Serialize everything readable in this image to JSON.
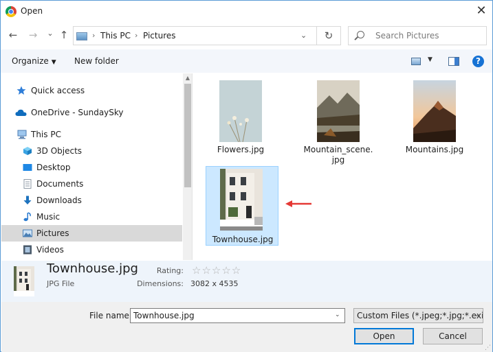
{
  "window": {
    "title": "Open",
    "close_glyph": "✕"
  },
  "nav": {
    "back_glyph": "←",
    "forward_glyph": "→",
    "recent_glyph": "⌄",
    "up_glyph": "↑",
    "breadcrumb": [
      "This PC",
      "Pictures"
    ],
    "separator": "›",
    "dropdown_glyph": "⌄",
    "refresh_glyph": "↻",
    "search_placeholder": "Search Pictures"
  },
  "toolbar": {
    "organize_label": "Organize",
    "caret": "▼",
    "new_folder_label": "New folder",
    "help_glyph": "?"
  },
  "sidebar": {
    "items": [
      {
        "label": "Quick access",
        "icon": "star-icon",
        "color": "#2f7ed8"
      },
      {
        "label": "OneDrive - SundaySky",
        "icon": "cloud-icon",
        "color": "#0f6cbd"
      },
      {
        "label": "This PC",
        "icon": "computer-icon",
        "color": "#5b8cc4"
      },
      {
        "label": "3D Objects",
        "icon": "cube-icon",
        "color": "#3aa3e3"
      },
      {
        "label": "Desktop",
        "icon": "desktop-icon",
        "color": "#1e88e5"
      },
      {
        "label": "Documents",
        "icon": "document-icon",
        "color": "#8e9aa6"
      },
      {
        "label": "Downloads",
        "icon": "download-icon",
        "color": "#1e73be"
      },
      {
        "label": "Music",
        "icon": "music-icon",
        "color": "#2b7bd0"
      },
      {
        "label": "Pictures",
        "icon": "pictures-icon",
        "color": "#4a7fb5"
      },
      {
        "label": "Videos",
        "icon": "video-icon",
        "color": "#4a5a6a"
      }
    ],
    "selected_label": "Pictures"
  },
  "files": [
    {
      "name": "Flowers.jpg",
      "line2": "",
      "icon": "image-thumbnail"
    },
    {
      "name": "Mountain_scene.",
      "line2": "jpg",
      "icon": "image-thumbnail"
    },
    {
      "name": "Mountains.jpg",
      "line2": "",
      "icon": "image-thumbnail"
    },
    {
      "name": "Townhouse.jpg",
      "line2": "",
      "icon": "image-thumbnail",
      "selected": true
    }
  ],
  "details": {
    "name": "Townhouse.jpg",
    "type": "JPG File",
    "rating_label": "Rating:",
    "rating_stars": "☆☆☆☆☆",
    "rating_value": 0,
    "dimensions_label": "Dimensions:",
    "dimensions_value": "3082 x 4535"
  },
  "footer": {
    "file_name_label": "File name:",
    "file_name_value": "Townhouse.jpg",
    "filter_value": "Custom Files (*.jpeg;*.jpg;*.exif",
    "dropdown_glyph": "⌄",
    "open_label": "Open",
    "cancel_label": "Cancel"
  },
  "colors": {
    "accent": "#0078d7",
    "selection": "#cce8ff",
    "arrow": "#e53935"
  }
}
